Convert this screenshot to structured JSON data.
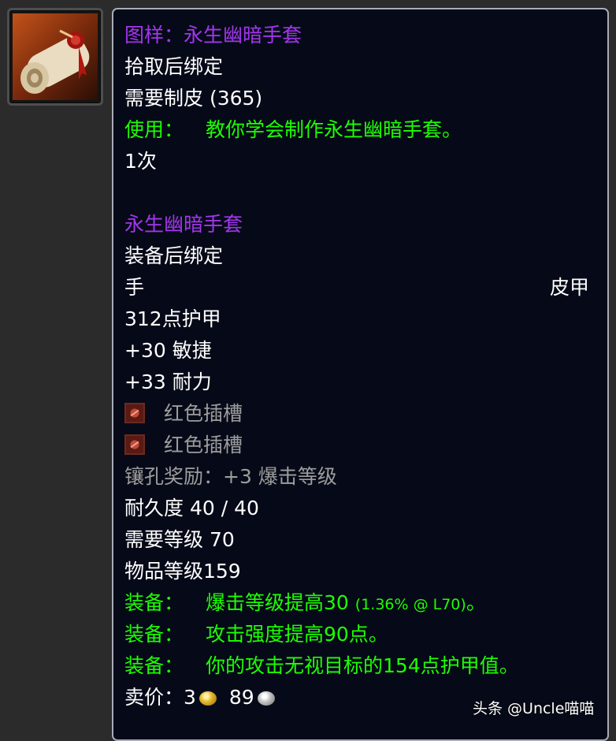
{
  "pattern": {
    "title": "图样：永生幽暗手套",
    "bind": "拾取后绑定",
    "requires": "需要制皮 (365)",
    "use_prefix": "使用：",
    "use_text": "教你学会制作永生幽暗手套。",
    "charges": "1次"
  },
  "item": {
    "name": "永生幽暗手套",
    "bind": "装备后绑定",
    "slot": "手",
    "type": "皮甲",
    "armor": "312点护甲",
    "stat1": "+30 敏捷",
    "stat2": "+33 耐力",
    "socket1": "红色插槽",
    "socket2": "红色插槽",
    "socket_bonus": "镶孔奖励：+3 爆击等级",
    "durability": "耐久度 40 / 40",
    "req_level": "需要等级 70",
    "item_level": "物品等级159",
    "equip_prefix": "装备：",
    "equip1": "爆击等级提高30",
    "equip1_pct": "(1.36% @ L70)",
    "equip1_end": "。",
    "equip2": "攻击强度提高90点。",
    "equip3": "你的攻击无视目标的154点护甲值。",
    "sell_label": "卖价：",
    "sell_gold": "3",
    "sell_silver": "89"
  },
  "watermark": "头条 @Uncle喵喵",
  "colors": {
    "epic": "#a335ee",
    "green": "#1eff00",
    "gray": "#9d9d9d",
    "tooltip_bg": "#060a18"
  },
  "icon": "recipe-scroll-icon"
}
